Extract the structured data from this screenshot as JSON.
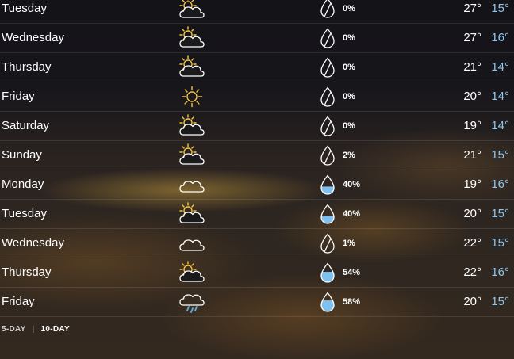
{
  "forecast": [
    {
      "day": "Tuesday",
      "icon": "partly-sunny-icon",
      "precip": "0%",
      "hi": "27°",
      "lo": "15°",
      "rain_fill": 0
    },
    {
      "day": "Wednesday",
      "icon": "partly-sunny-icon",
      "precip": "0%",
      "hi": "27°",
      "lo": "16°",
      "rain_fill": 0
    },
    {
      "day": "Thursday",
      "icon": "partly-sunny-icon",
      "precip": "0%",
      "hi": "21°",
      "lo": "14°",
      "rain_fill": 0
    },
    {
      "day": "Friday",
      "icon": "sun-icon",
      "precip": "0%",
      "hi": "20°",
      "lo": "14°",
      "rain_fill": 0
    },
    {
      "day": "Saturday",
      "icon": "partly-sunny-icon",
      "precip": "0%",
      "hi": "19°",
      "lo": "14°",
      "rain_fill": 0
    },
    {
      "day": "Sunday",
      "icon": "partly-sunny-icon",
      "precip": "2%",
      "hi": "21°",
      "lo": "15°",
      "rain_fill": 0.02
    },
    {
      "day": "Monday",
      "icon": "cloud-icon",
      "precip": "40%",
      "hi": "19°",
      "lo": "16°",
      "rain_fill": 0.4
    },
    {
      "day": "Tuesday",
      "icon": "partly-sunny-icon",
      "precip": "40%",
      "hi": "20°",
      "lo": "15°",
      "rain_fill": 0.4
    },
    {
      "day": "Wednesday",
      "icon": "cloud-icon",
      "precip": "1%",
      "hi": "22°",
      "lo": "15°",
      "rain_fill": 0.01
    },
    {
      "day": "Thursday",
      "icon": "partly-sunny-icon",
      "precip": "54%",
      "hi": "22°",
      "lo": "16°",
      "rain_fill": 0.54
    },
    {
      "day": "Friday",
      "icon": "rain-cloud-icon",
      "precip": "58%",
      "hi": "20°",
      "lo": "15°",
      "rain_fill": 0.58
    }
  ],
  "footer": {
    "five_day": "5-DAY",
    "separator": "|",
    "ten_day": "10-DAY"
  },
  "colors": {
    "sun": "#f5c542",
    "rain": "#5aaee8",
    "low_temp": "#8cc7f2",
    "drop_fill": "#7fc0ee"
  }
}
